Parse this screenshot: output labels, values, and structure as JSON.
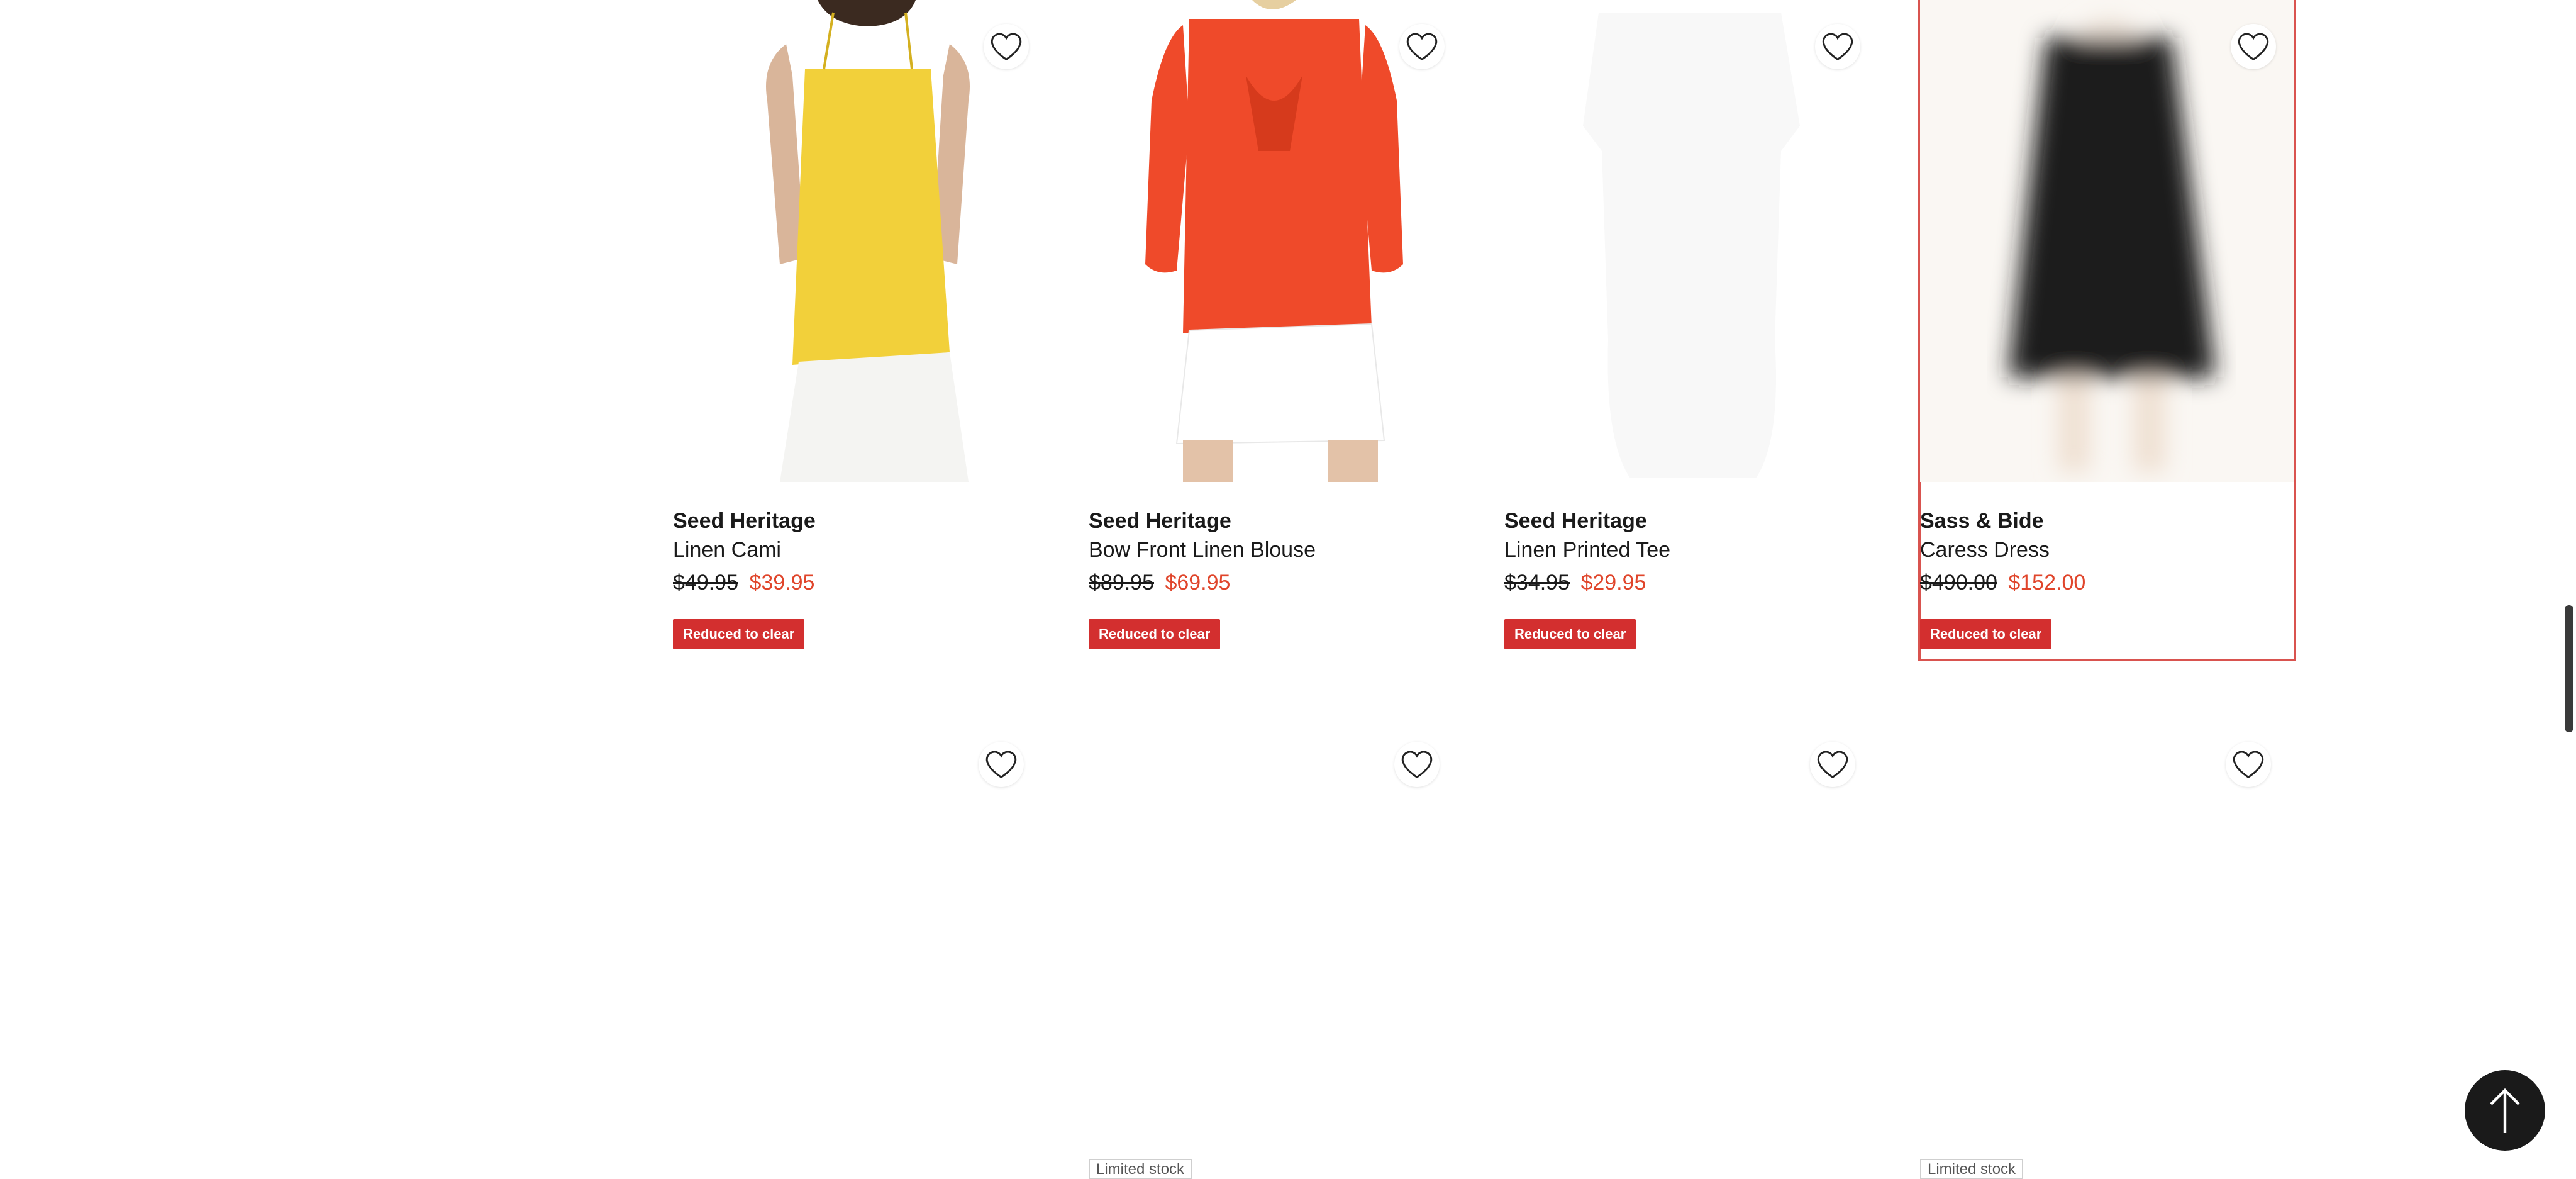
{
  "products_row1": [
    {
      "brand": "Seed Heritage",
      "name": "Linen Cami",
      "was_price": "$49.95",
      "now_price": "$39.95",
      "badge": "Reduced to clear",
      "image_colors": {
        "garment": "#f2d03a",
        "bottom": "#ffffff",
        "skin": "#d9b59a"
      }
    },
    {
      "brand": "Seed Heritage",
      "name": "Bow Front Linen Blouse",
      "was_price": "$89.95",
      "now_price": "$69.95",
      "badge": "Reduced to clear",
      "image_colors": {
        "garment": "#ef4a2a",
        "bottom": "#ffffff",
        "skin": "#e3c2a8"
      }
    },
    {
      "brand": "Seed Heritage",
      "name": "Linen Printed Tee",
      "was_price": "$34.95",
      "now_price": "$29.95",
      "badge": "Reduced to clear",
      "image_colors": {
        "garment": "#f7f7f7"
      }
    },
    {
      "brand": "Sass & Bide",
      "name": "Caress Dress",
      "was_price": "$490.00",
      "now_price": "$152.00",
      "badge": "Reduced to clear",
      "image_colors": {
        "garment": "#1e1e1e",
        "skin": "#f0e6df"
      }
    }
  ],
  "row2_badges": [
    "Limited stock",
    "Limited stock"
  ],
  "icons": {
    "favourite": "heart-outline-icon",
    "back_to_top": "arrow-up-icon"
  },
  "colors": {
    "sale_price": "#e0452b",
    "badge_bg": "#d32f2f",
    "highlight_border": "#d9534f",
    "back_to_top_bg": "#1a1a1a"
  }
}
